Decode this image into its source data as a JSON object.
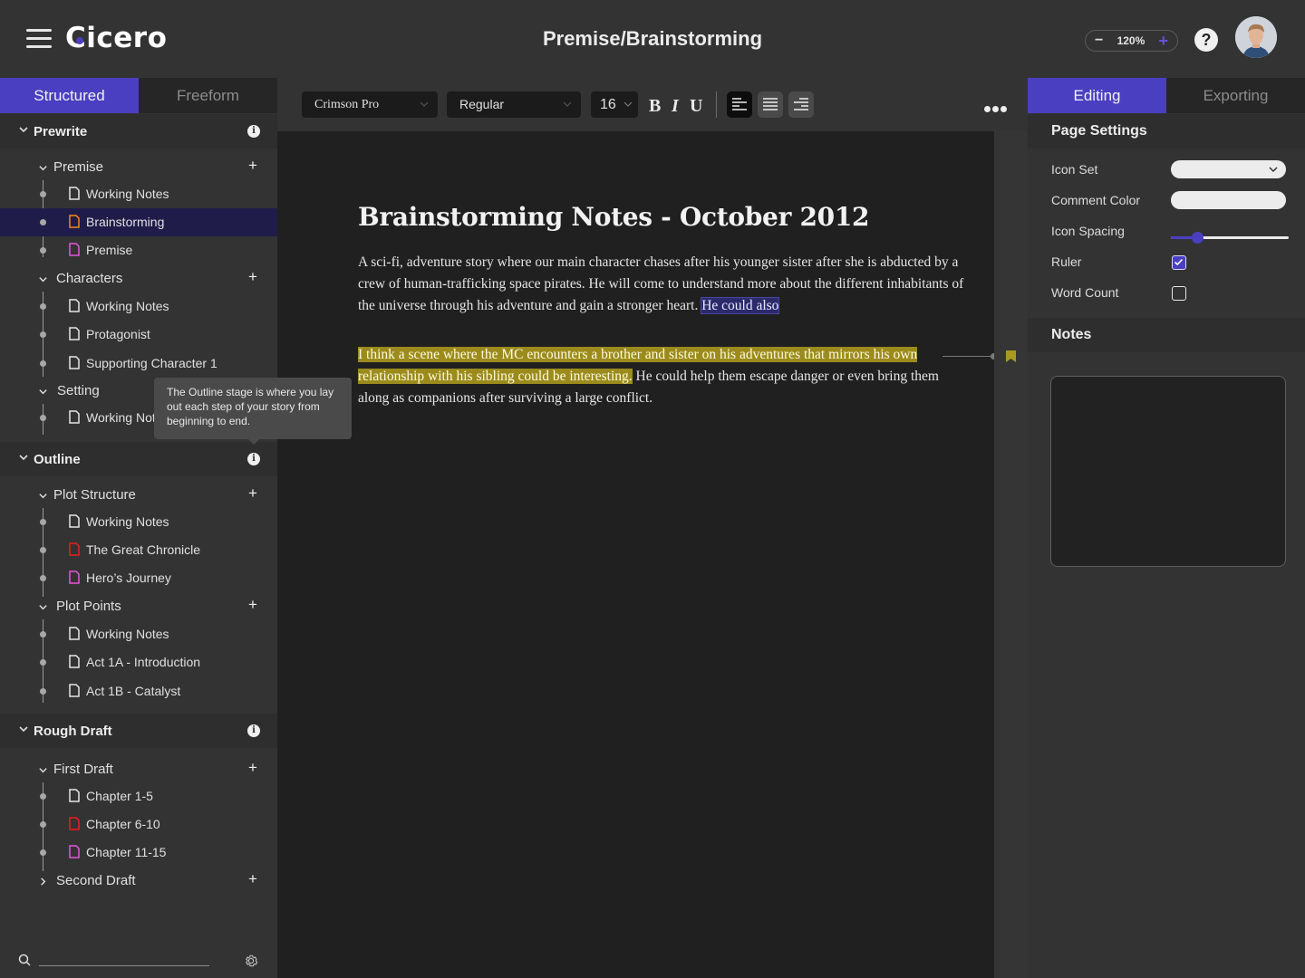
{
  "app": {
    "name": "Cicero",
    "page_title": "Premise/Brainstorming",
    "zoom_level": "120%",
    "zoom_minus": "−",
    "zoom_plus": "+",
    "help_label": "?",
    "accent_color": "#4a3fc1"
  },
  "left_tabs": [
    {
      "label": "Structured",
      "active": true
    },
    {
      "label": "Freeform",
      "active": false
    }
  ],
  "tree": {
    "stages": [
      {
        "label": "Prewrite",
        "info": "i"
      },
      {
        "label": "Outline",
        "info": "i"
      },
      {
        "label": "Rough Draft",
        "info": "i"
      }
    ],
    "groups": [
      {
        "label": "Premise",
        "expanded": true,
        "add": "+"
      },
      {
        "label": "Characters",
        "expanded": true,
        "add": "+"
      },
      {
        "label": "Setting",
        "expanded": true,
        "add": "+"
      },
      {
        "label": "Plot Structure",
        "expanded": true,
        "add": "+"
      },
      {
        "label": "Plot Points",
        "expanded": true,
        "add": "+"
      },
      {
        "label": "First Draft",
        "expanded": true,
        "add": "+"
      },
      {
        "label": "Second Draft",
        "expanded": false,
        "add": "+"
      }
    ],
    "items": [
      {
        "label": "Working Notes",
        "color": "#e6e6e6"
      },
      {
        "label": "Brainstorming",
        "color": "#f08a1c",
        "selected": true
      },
      {
        "label": "Premise",
        "color": "#e05ad8"
      },
      {
        "label": "Working Notes",
        "color": "#e6e6e6"
      },
      {
        "label": "Protagonist",
        "color": "#e6e6e6"
      },
      {
        "label": "Supporting Character 1",
        "color": "#e6e6e6"
      },
      {
        "label": "Working Notes",
        "color": "#e6e6e6"
      },
      {
        "label": "Working Notes",
        "color": "#e6e6e6"
      },
      {
        "label": "The Great Chronicle",
        "color": "#e8201c"
      },
      {
        "label": "Hero’s Journey",
        "color": "#e05ad8"
      },
      {
        "label": "Working Notes",
        "color": "#e6e6e6"
      },
      {
        "label": "Act 1A - Introduction",
        "color": "#e6e6e6"
      },
      {
        "label": "Act 1B - Catalyst",
        "color": "#e6e6e6"
      },
      {
        "label": "Chapter 1-5",
        "color": "#e6e6e6"
      },
      {
        "label": "Chapter 6-10",
        "color": "#e8201c"
      },
      {
        "label": "Chapter 11-15",
        "color": "#e05ad8"
      }
    ]
  },
  "tooltip": {
    "text": "The Outline stage is where you lay out each step of your story from beginning to end."
  },
  "sidebar_footer": {
    "search_placeholder": "",
    "search_value": ""
  },
  "toolbar": {
    "font_family": "Crimson Pro",
    "font_weight": "Regular",
    "font_size": "16",
    "bold": "B",
    "italic": "I",
    "underline": "U",
    "alignment": "left"
  },
  "document": {
    "title": "Brainstorming Notes - October 2012",
    "para1_text": "A sci-fi, adventure story where our main character chases after his younger sister after she is abducted by a crew of human-trafficking space pirates. He will come to understand more about the different inhabitants of the universe through his adventure and gain a stronger heart. ",
    "para1_selected": "He could also",
    "para2_highlighted": "I think a scene where the MC encounters a brother and sister on his adventures that mirrors his own relationship with his sibling could be interesting.",
    "para2_rest": " He could help them escape danger or even bring them along as companions after surviving a large conflict.",
    "highlight_color": "#9b8b1c"
  },
  "right_tabs": [
    {
      "label": "Editing",
      "active": true
    },
    {
      "label": "Exporting",
      "active": false
    }
  ],
  "page_settings": {
    "heading": "Page Settings",
    "icon_set_label": "Icon Set",
    "icon_set_value": "",
    "comment_color_label": "Comment Color",
    "comment_color_value": "#ececec",
    "icon_spacing_label": "Icon Spacing",
    "icon_spacing_fraction": 0.22,
    "ruler_label": "Ruler",
    "ruler_checked": true,
    "word_count_label": "Word Count",
    "word_count_checked": false
  },
  "notes": {
    "heading": "Notes",
    "value": ""
  }
}
